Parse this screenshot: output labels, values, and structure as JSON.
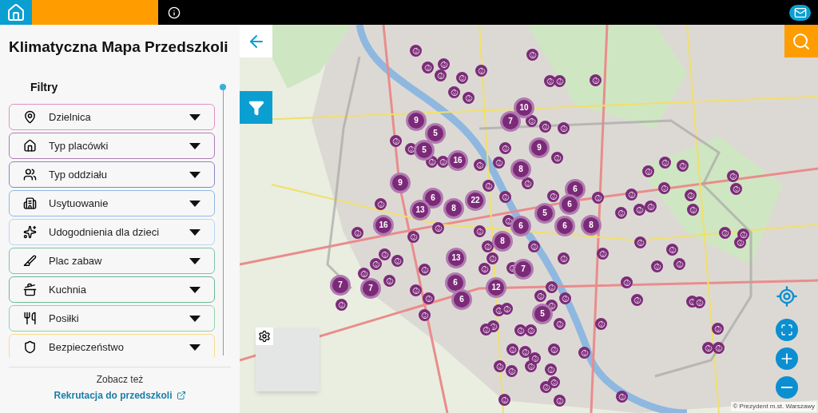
{
  "app": {
    "title": "Klimatyczna Mapa Przedszkoli"
  },
  "filters": {
    "heading": "Filtry",
    "items": [
      {
        "label": "Dzielnica",
        "color": "#e58fc0"
      },
      {
        "label": "Typ placówki",
        "color": "#b07ab5"
      },
      {
        "label": "Typ oddziału",
        "color": "#8a86c4"
      },
      {
        "label": "Usytuowanie",
        "color": "#8fb8e8"
      },
      {
        "label": "Udogodnienia dla dzieci",
        "color": "#b8d4f0"
      },
      {
        "label": "Plac zabaw",
        "color": "#7cc4a8"
      },
      {
        "label": "Kuchnia",
        "color": "#6bb894"
      },
      {
        "label": "Posiłki",
        "color": "#8ed4a8"
      },
      {
        "label": "Bezpieczeństwo",
        "color": "#f5dc8c"
      }
    ]
  },
  "footer": {
    "see_also": "Zobacz też",
    "link": "Rekrutacja do przedszkoli"
  },
  "map": {
    "clusters": [
      "10",
      "9",
      "7",
      "5",
      "5",
      "9",
      "16",
      "8",
      "9",
      "6",
      "6",
      "22",
      "6",
      "13",
      "8",
      "5",
      "16",
      "6",
      "6",
      "8",
      "8",
      "13",
      "7",
      "7",
      "7",
      "6",
      "12",
      "6",
      "5"
    ],
    "attribution": "© Prezydent m.st. Warszawy"
  }
}
